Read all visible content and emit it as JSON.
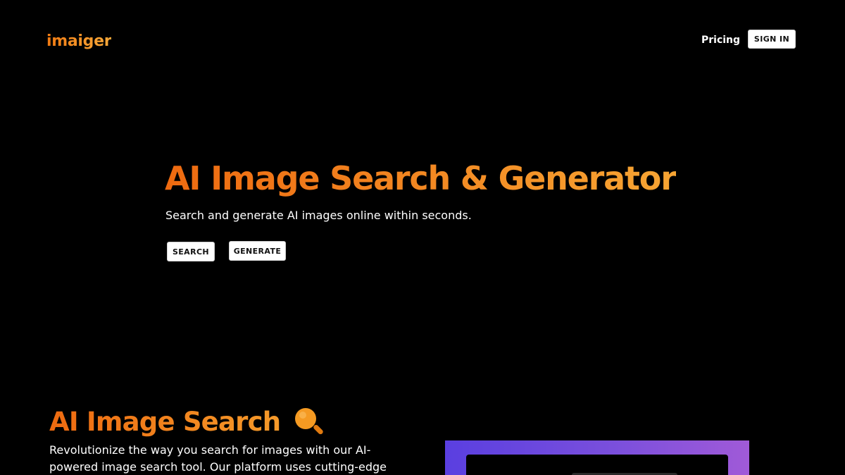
{
  "header": {
    "logo": "imaiger",
    "nav": {
      "pricing": "Pricing",
      "sign_in": "SIGN IN"
    }
  },
  "hero": {
    "title": "AI Image Search & Generator",
    "subtitle": "Search and generate AI images online within seconds.",
    "search_label": "SEARCH",
    "generate_label": "GENERATE"
  },
  "section": {
    "title": "AI Image Search",
    "icon": "magnifying-glass-icon",
    "text": "Revolutionize the way you search for images with our AI-powered image search tool. Our platform uses cutting-edge technology to"
  },
  "colors": {
    "background": "#000000",
    "accent_start": "#ee6a10",
    "accent_end": "#f7a533",
    "preview_gradient_start": "#5a3fe0",
    "preview_gradient_end": "#a05ad8"
  }
}
